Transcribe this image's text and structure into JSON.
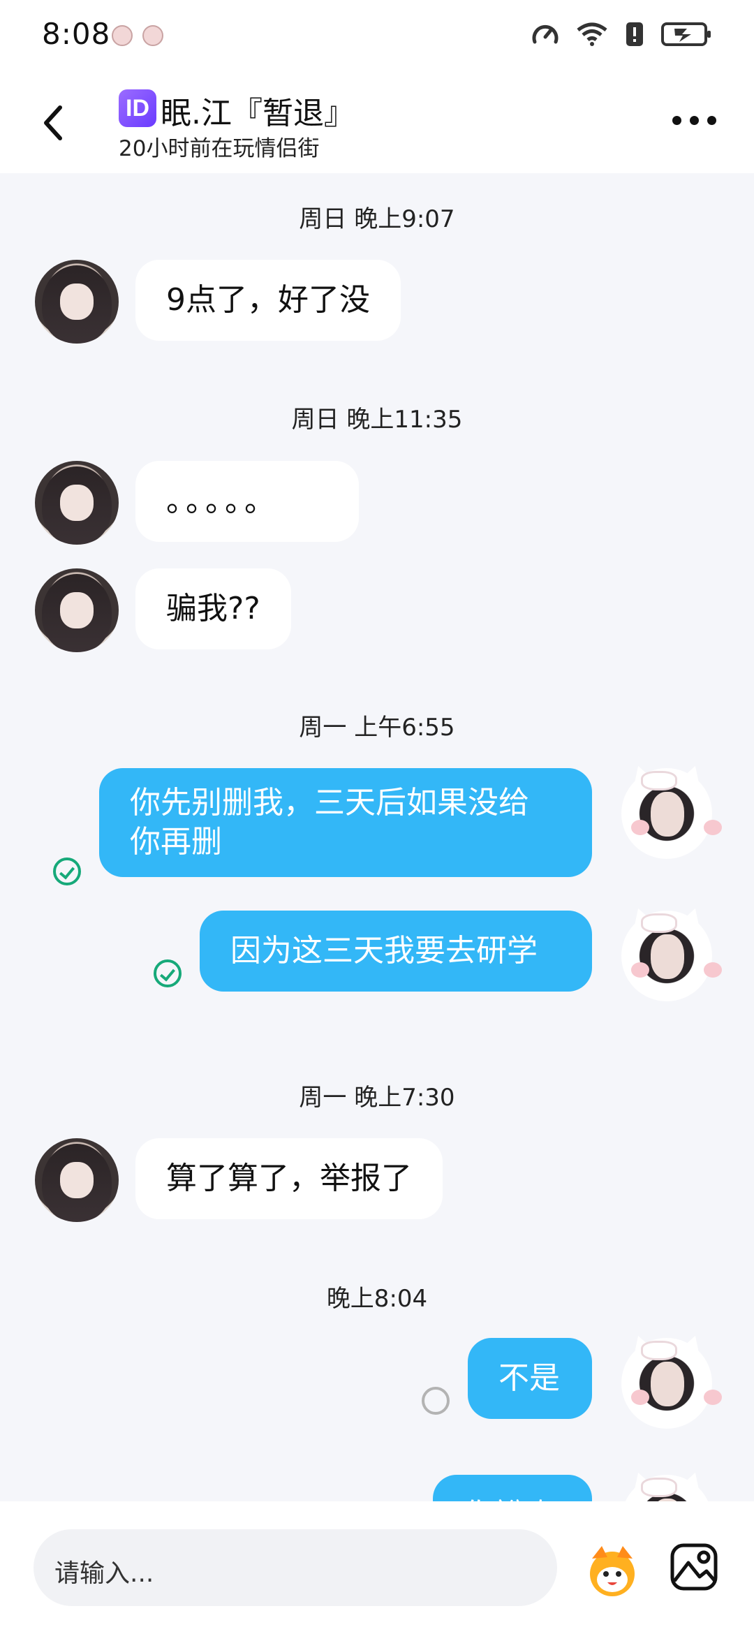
{
  "status_bar": {
    "time": "8:08"
  },
  "header": {
    "id_badge": "ID",
    "nickname": "眠.江『暂退』",
    "subtitle": "20小时前在玩情侣街"
  },
  "messages": [
    {
      "type": "time",
      "text": "周日 晚上9:07"
    },
    {
      "type": "in",
      "text": "9点了，好了没"
    },
    {
      "type": "time",
      "text": "周日 晚上11:35"
    },
    {
      "type": "in",
      "text": "。。。。。"
    },
    {
      "type": "in",
      "text": "骗我??"
    },
    {
      "type": "time",
      "text": "周一 上午6:55"
    },
    {
      "type": "out",
      "text": "你先别删我，三天后如果没给\n你再删",
      "status": "read"
    },
    {
      "type": "out",
      "text": "因为这三天我要去研学",
      "status": "read"
    },
    {
      "type": "time",
      "text": "周一 晚上7:30"
    },
    {
      "type": "in",
      "text": "算了算了，举报了"
    },
    {
      "type": "time",
      "text": "晚上8:04"
    },
    {
      "type": "out",
      "text": "不是",
      "status": "sending"
    },
    {
      "type": "out",
      "text": "你說吻",
      "status": "partial"
    }
  ],
  "input": {
    "placeholder": "请输入..."
  },
  "icons": {
    "back": "chevron-left-icon",
    "more": "more-horizontal-icon",
    "emoji": "mascot-emoji-icon",
    "gallery": "image-gallery-icon",
    "speed": "speedometer-icon",
    "wifi": "wifi-icon",
    "alert": "alert-icon",
    "battery": "battery-charging-icon"
  },
  "colors": {
    "outgoing_bubble": "#33b7f7",
    "read_check": "#16a979",
    "id_badge": "#7b4dff"
  }
}
